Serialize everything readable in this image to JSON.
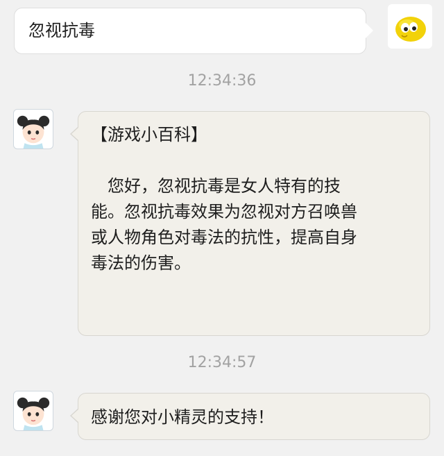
{
  "messages": [
    {
      "sender": "user",
      "text": "忽视抗毒"
    },
    {
      "sender": "bot",
      "time": "12:34:36",
      "title": "【游戏小百科】",
      "lines": [
        "您好，忽视抗毒是女人特有的技",
        "能。忽视抗毒效果为忽视对方召唤兽",
        "或人物角色对毒法的抗性，提高自身",
        "毒法的伤害。"
      ]
    },
    {
      "sender": "bot",
      "time": "12:34:57",
      "text": "感谢您对小精灵的支持！"
    }
  ],
  "avatars": {
    "user": "yellow-smiley-face-icon",
    "bot": "girl-with-hair-buns-avatar"
  },
  "colors": {
    "background": "#f1f1f1",
    "user_bubble": "#ffffff",
    "bot_bubble": "#f2f0ea",
    "timestamp": "#a2a2a2"
  }
}
